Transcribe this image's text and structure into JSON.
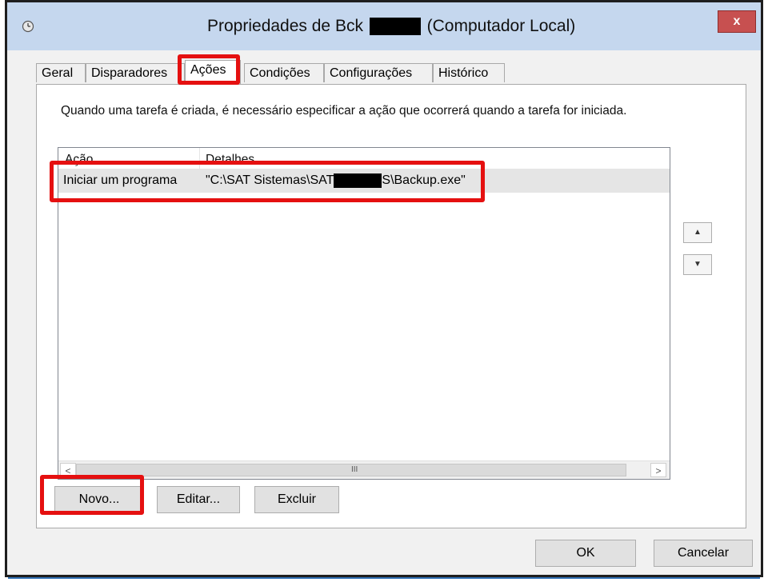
{
  "window": {
    "title_prefix": "Propriedades de Bck",
    "title_suffix": "(Computador Local)",
    "close_label": "x"
  },
  "tabs": [
    {
      "label": "Geral",
      "active": false
    },
    {
      "label": "Disparadores",
      "active": false
    },
    {
      "label": "Ações",
      "active": true
    },
    {
      "label": "Condições",
      "active": false
    },
    {
      "label": "Configurações",
      "active": false
    },
    {
      "label": "Histórico",
      "active": false
    }
  ],
  "actions_tab": {
    "description": "Quando uma tarefa é criada, é necessário especificar a ação que ocorrerá quando a tarefa for iniciada.",
    "columns": [
      "Ação",
      "Detalhes"
    ],
    "rows": [
      {
        "action": "Iniciar um programa",
        "details_prefix": "\"C:\\SAT Sistemas\\SAT",
        "details_suffix": "S\\Backup.exe\""
      }
    ],
    "scroll_left": "<",
    "scroll_right": ">",
    "scroll_grip": "III",
    "move_up": "▲",
    "move_down": "▼",
    "buttons": {
      "new": "Novo...",
      "edit": "Editar...",
      "delete": "Excluir"
    }
  },
  "footer": {
    "ok": "OK",
    "cancel": "Cancelar"
  },
  "colors": {
    "highlight": "#e51010",
    "titlebar": "#c5d7ee",
    "close": "#c75050"
  }
}
